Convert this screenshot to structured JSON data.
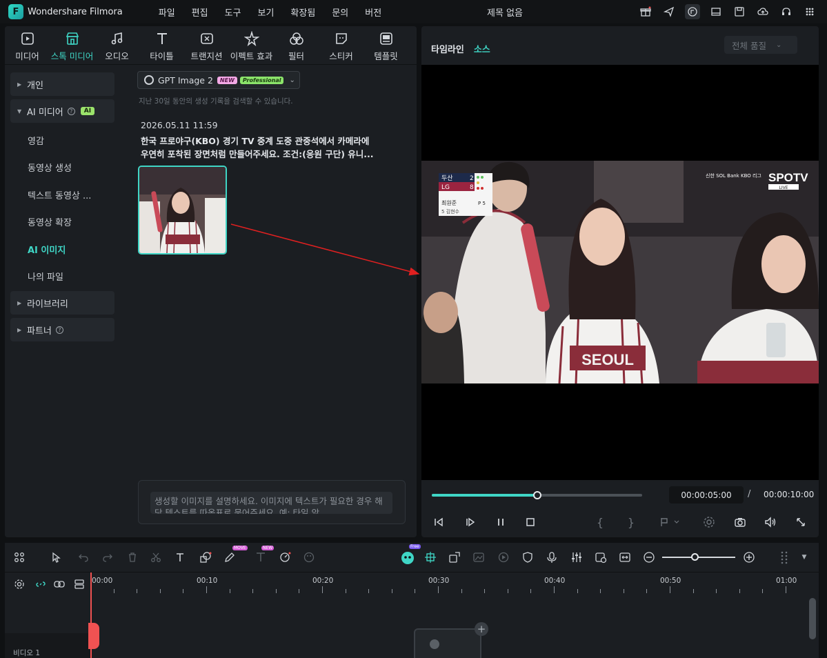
{
  "app": {
    "name": "Wondershare Filmora",
    "document_title": "제목 없음"
  },
  "menu": [
    "파일",
    "편집",
    "도구",
    "보기",
    "확장됨",
    "문의",
    "버전"
  ],
  "library_tabs": [
    {
      "label": "미디어",
      "icon": "media-icon",
      "active": false
    },
    {
      "label": "스톡 미디어",
      "icon": "stock-media-icon",
      "active": true
    },
    {
      "label": "오디오",
      "icon": "music-note-icon",
      "active": false
    },
    {
      "label": "타이틀",
      "icon": "title-text-icon",
      "active": false
    },
    {
      "label": "트랜지션",
      "icon": "transition-icon",
      "active": false
    },
    {
      "label": "이펙트 효과",
      "icon": "effects-sparkle-icon",
      "active": false
    },
    {
      "label": "필터",
      "icon": "filter-icon",
      "active": false
    },
    {
      "label": "스티커",
      "icon": "sticker-icon",
      "active": false
    },
    {
      "label": "템플릿",
      "icon": "template-icon",
      "active": false
    }
  ],
  "sidebar": {
    "personal": "개인",
    "ai_media": "AI 미디어",
    "ai_badge": "AI",
    "items": [
      "영감",
      "동영상 생성",
      "텍스트 동영상 ...",
      "동영상 확장",
      "AI 이미지",
      "나의 파일"
    ],
    "active_item": "AI 이미지",
    "library": "라이브러리",
    "partner": "파트너"
  },
  "generator": {
    "model": "GPT Image 2",
    "badge_new": "NEW",
    "badge_pro": "Professional",
    "hint": "지난 30일 동안의 생성 기록을 검색할 수 있습니다.",
    "timestamp": "2026.05.11 11:59",
    "prompt_line1": "한국 프로야구(KBO) 경기 TV 중계 도중 관중석에서 카메라에",
    "prompt_line2": "우연히 포착된 장면처럼 만들어주세요. 조건:(응원 구단) 유니...",
    "input_placeholder": "생성할 이미지를 설명하세요. 이미지에 텍스트가 필요한 경우 해당 텍스트를 따옴표로 묶어주세요. 예: 타일 앞"
  },
  "preview": {
    "tab_timeline": "타임라인",
    "tab_source": "소스",
    "quality": "전체 품질",
    "current_time": "00:00:05:00",
    "separator": "/",
    "total_time": "00:00:10:00",
    "progress": 0.5,
    "scoreboard": {
      "team1": "두산",
      "score1": "2",
      "team2": "LG",
      "score2": "8",
      "batter": "최원준",
      "count": "P 5",
      "sub": "5 김현수"
    },
    "broadcast": "SPOTV",
    "broadcast_live": "LIVE",
    "league": "신한 SOL Bank KBO 리그",
    "jersey_text": "SEOUL"
  },
  "timeline": {
    "ticks": [
      "00:00",
      "00:10",
      "00:20",
      "00:30",
      "00:40",
      "00:50",
      "01:00"
    ],
    "track_label": "비디오 1",
    "badges": {
      "free": "Free",
      "new": "NEW",
      "move": "MOVE"
    }
  },
  "colors": {
    "accent": "#3fd6c6",
    "playhead": "#f05252",
    "annotation_arrow": "#e02020"
  }
}
